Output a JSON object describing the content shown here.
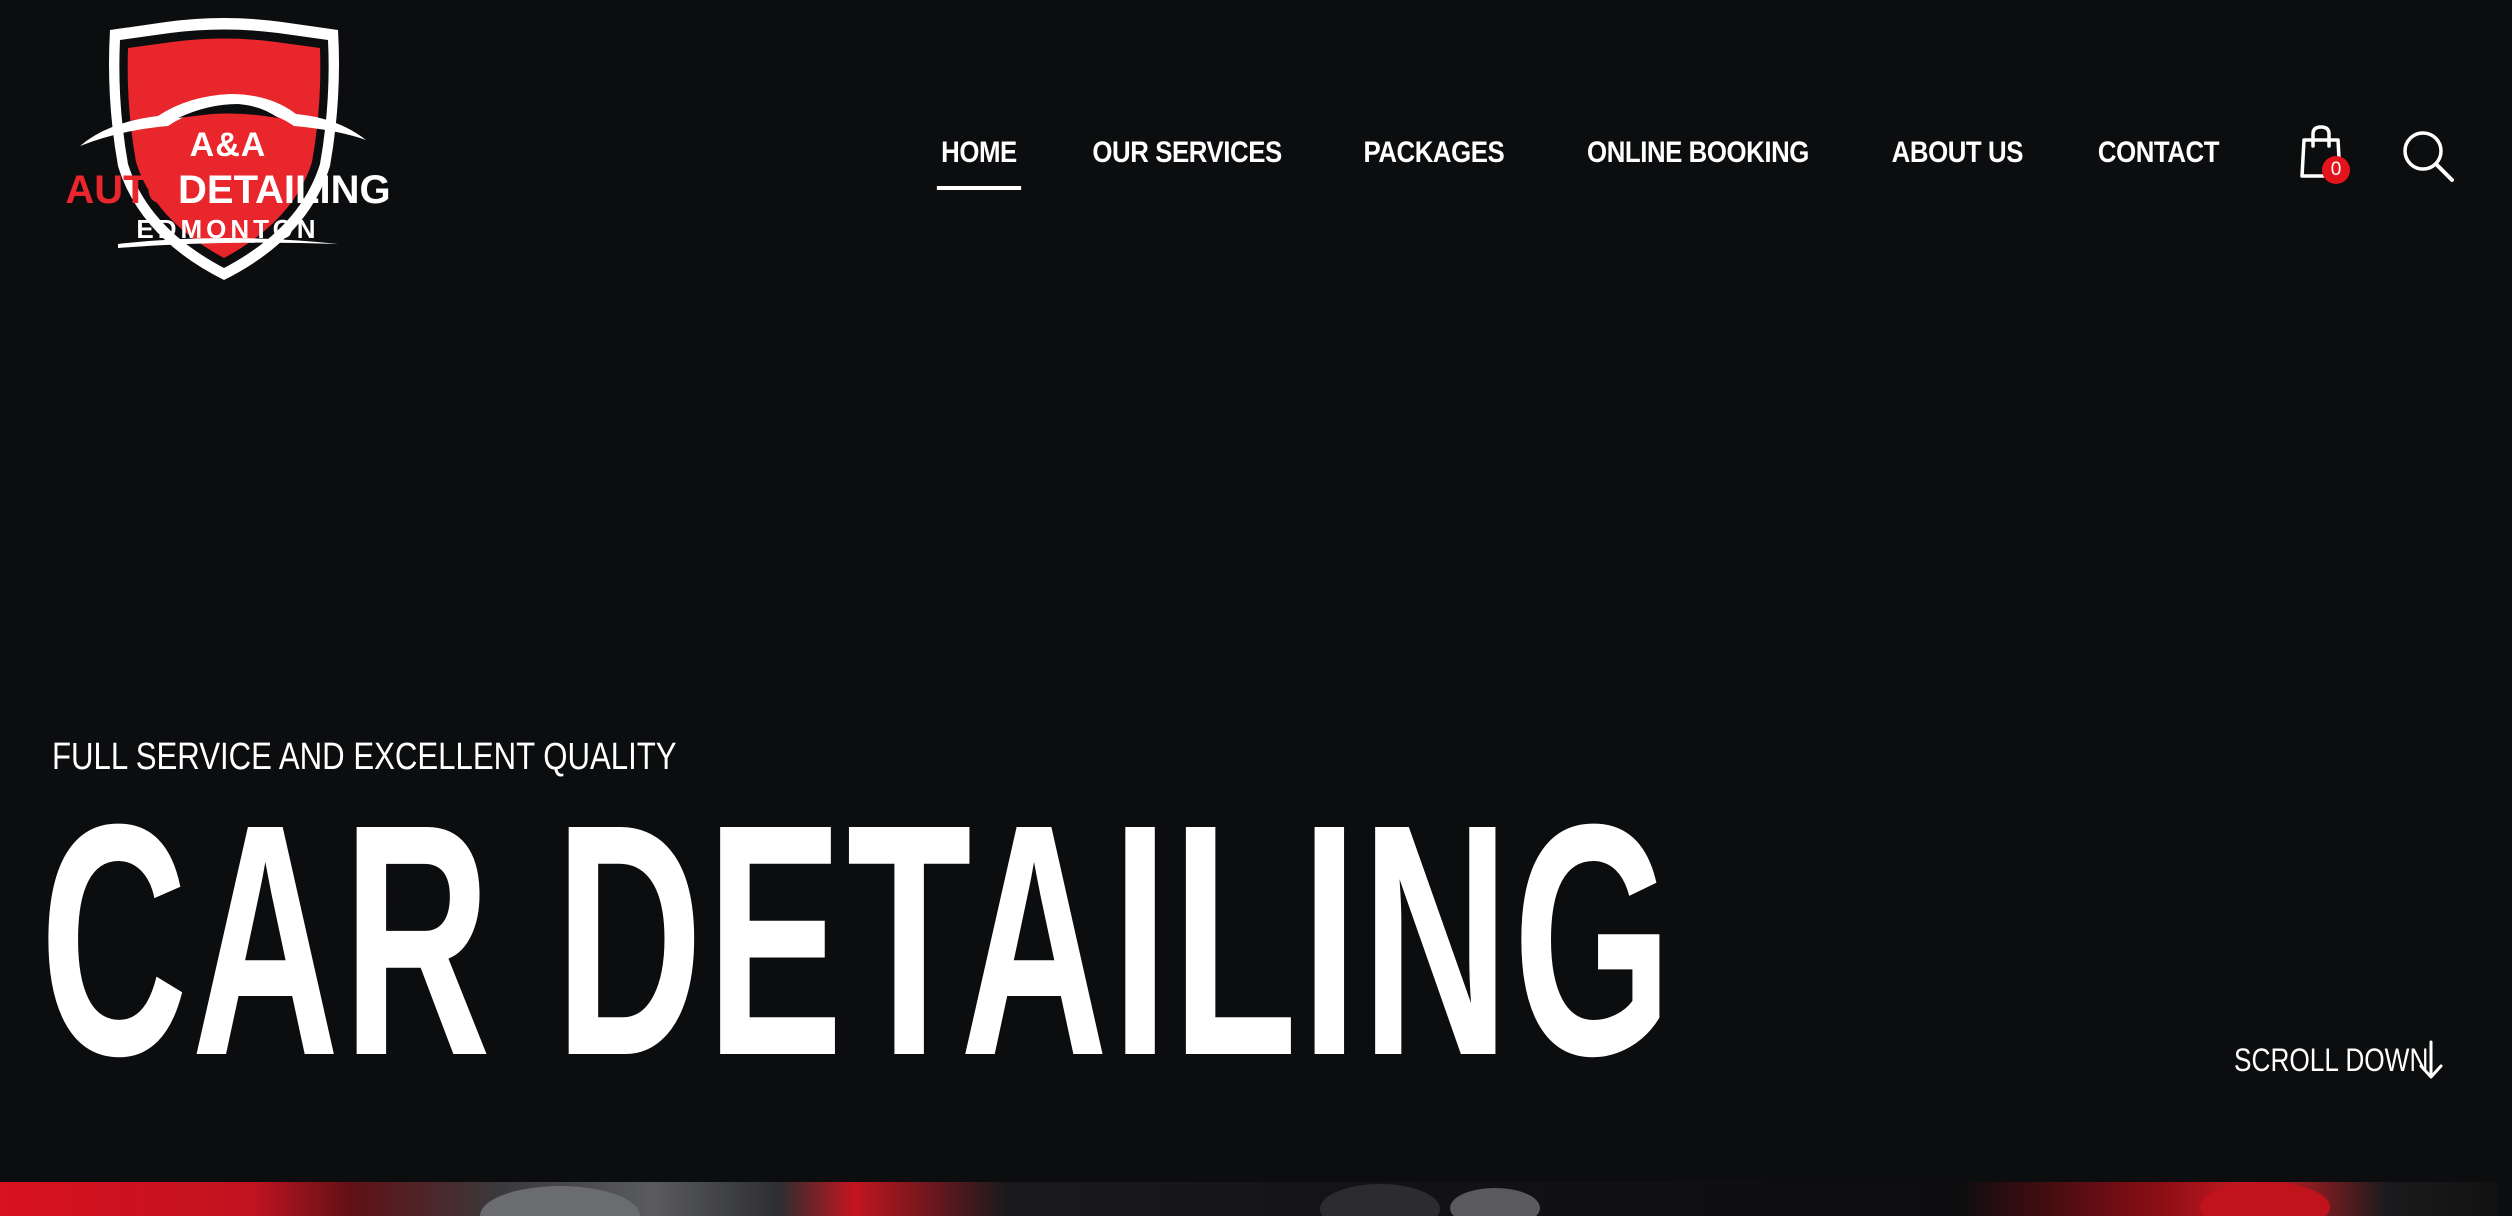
{
  "logo": {
    "line1": "A&A",
    "line2_red": "AUTO",
    "line2_white": "DETAILING",
    "line3": "EDMONTON"
  },
  "nav": {
    "items": [
      {
        "label": "HOME",
        "active": true
      },
      {
        "label": "OUR SERVICES",
        "active": false
      },
      {
        "label": "PACKAGES",
        "active": false
      },
      {
        "label": "ONLINE BOOKING",
        "active": false
      },
      {
        "label": "ABOUT US",
        "active": false
      },
      {
        "label": "CONTACT",
        "active": false
      }
    ]
  },
  "cart": {
    "icon": "shopping-bag-icon",
    "count": "0"
  },
  "search": {
    "icon": "search-icon"
  },
  "hero": {
    "subtitle": "FULL SERVICE AND EXCELLENT QUALITY",
    "title": "CAR DETAILING"
  },
  "scroll": {
    "label": "SCROLL DOWN",
    "icon": "arrow-down-icon"
  },
  "colors": {
    "background": "#0c0d0f",
    "accent_red": "#e8262b",
    "badge_red": "#e3141b",
    "text": "#ffffff"
  }
}
